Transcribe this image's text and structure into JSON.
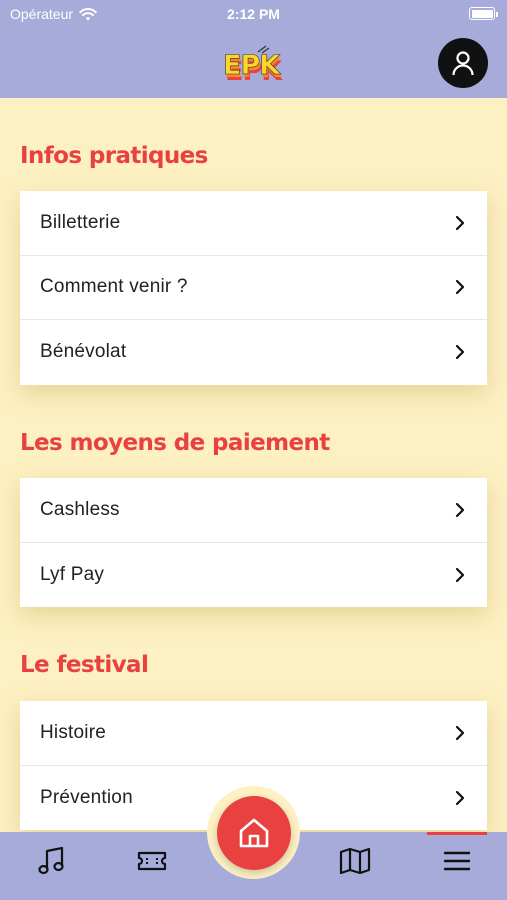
{
  "status_bar": {
    "carrier": "Opérateur",
    "time": "2:12 PM"
  },
  "header": {
    "logo_text": "EPK",
    "avatar_icon": "user-icon"
  },
  "sections": [
    {
      "title": "Infos pratiques",
      "items": [
        {
          "label": "Billetterie"
        },
        {
          "label": "Comment venir ?"
        },
        {
          "label": "Bénévolat"
        }
      ]
    },
    {
      "title": "Les moyens de paiement",
      "items": [
        {
          "label": "Cashless"
        },
        {
          "label": "Lyf Pay"
        }
      ]
    },
    {
      "title": "Le festival",
      "items": [
        {
          "label": "Histoire"
        },
        {
          "label": "Prévention"
        }
      ]
    }
  ],
  "tab_bar": {
    "tabs": [
      "music-note-icon",
      "ticket-icon",
      "home-icon",
      "map-icon",
      "menu-icon"
    ],
    "active": "menu-icon"
  },
  "colors": {
    "header_bg": "#a6abda",
    "page_bg": "#fdf0c2",
    "accent_red": "#e8413f",
    "logo_yellow": "#ffd52a"
  }
}
